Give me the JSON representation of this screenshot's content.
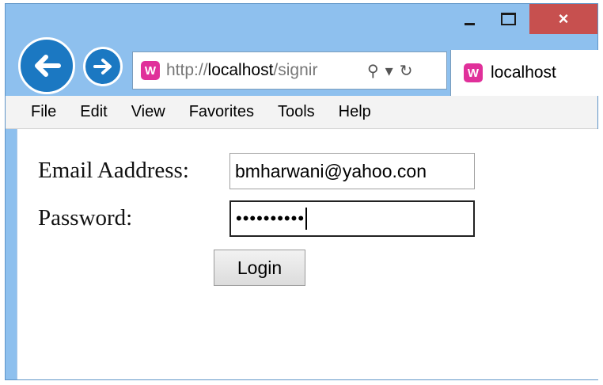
{
  "window": {
    "caption": {
      "minimize": "–",
      "maximize": "□",
      "close": "×"
    },
    "accent_color": "#1b78c2",
    "close_color": "#c7504f"
  },
  "nav": {
    "back_icon": "back-arrow-icon",
    "forward_icon": "forward-arrow-icon",
    "address": {
      "prefix": "http://",
      "host": "localhost",
      "path": "/signir",
      "site_icon": "wamp-server-icon",
      "search_glyph": "⚲",
      "dropdown_glyph": "▾",
      "refresh_glyph": "↻"
    },
    "tab": {
      "label": "localhost",
      "site_icon": "wamp-server-icon"
    }
  },
  "menu": {
    "items": [
      "File",
      "Edit",
      "View",
      "Favorites",
      "Tools",
      "Help"
    ]
  },
  "form": {
    "email_label": "Email Aaddress:",
    "email_value": "bmharwani@yahoo.con",
    "password_label": "Password:",
    "password_masked": "••••••••••",
    "login_label": "Login"
  }
}
